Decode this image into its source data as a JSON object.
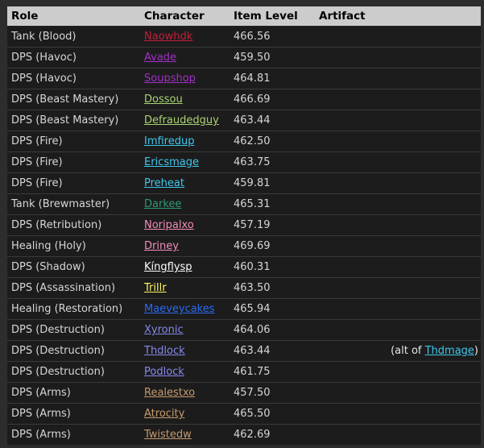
{
  "table": {
    "header": {
      "role": "Role",
      "character": "Character",
      "item_level": "Item Level",
      "artifact": "Artifact"
    },
    "class_colors": {
      "death-knight": "#C41E3A",
      "demon-hunter": "#A330C9",
      "hunter": "#AAD372",
      "mage": "#3FC7EB",
      "monk": "#2E9B77",
      "paladin": "#F48CBA",
      "priest": "#FFFFFF",
      "rogue": "#FFF468",
      "shaman": "#2B6AF0",
      "warlock": "#8788EE",
      "warrior": "#C69B6D"
    },
    "rows": [
      {
        "role": "Tank (Blood)",
        "character": "Naowhdk",
        "class": "death-knight",
        "item_level": "466.56",
        "artifact": null
      },
      {
        "role": "DPS (Havoc)",
        "character": "Avade",
        "class": "demon-hunter",
        "item_level": "459.50",
        "artifact": null
      },
      {
        "role": "DPS (Havoc)",
        "character": "Soupshop",
        "class": "demon-hunter",
        "item_level": "464.81",
        "artifact": null
      },
      {
        "role": "DPS (Beast Mastery)",
        "character": "Dossou",
        "class": "hunter",
        "item_level": "466.69",
        "artifact": null
      },
      {
        "role": "DPS (Beast Mastery)",
        "character": "Defraudedguy",
        "class": "hunter",
        "item_level": "463.44",
        "artifact": null
      },
      {
        "role": "DPS (Fire)",
        "character": "Imfiredup",
        "class": "mage",
        "item_level": "462.50",
        "artifact": null
      },
      {
        "role": "DPS (Fire)",
        "character": "Ericsmage",
        "class": "mage",
        "item_level": "463.75",
        "artifact": null
      },
      {
        "role": "DPS (Fire)",
        "character": "Preheat",
        "class": "mage",
        "item_level": "459.81",
        "artifact": null
      },
      {
        "role": "Tank (Brewmaster)",
        "character": "Darkee",
        "class": "monk",
        "item_level": "465.31",
        "artifact": null
      },
      {
        "role": "DPS (Retribution)",
        "character": "Noripalxo",
        "class": "paladin",
        "item_level": "457.19",
        "artifact": null
      },
      {
        "role": "Healing (Holy)",
        "character": "Driney",
        "class": "paladin",
        "item_level": "469.69",
        "artifact": null
      },
      {
        "role": "DPS (Shadow)",
        "character": "Kíngflysp",
        "class": "priest",
        "item_level": "460.31",
        "artifact": null
      },
      {
        "role": "DPS (Assassination)",
        "character": "Trillr",
        "class": "rogue",
        "item_level": "463.50",
        "artifact": null
      },
      {
        "role": "Healing (Restoration)",
        "character": "Maeveycakes",
        "class": "shaman",
        "item_level": "465.94",
        "artifact": null
      },
      {
        "role": "DPS (Destruction)",
        "character": "Xyronic",
        "class": "warlock",
        "item_level": "464.06",
        "artifact": null
      },
      {
        "role": "DPS (Destruction)",
        "character": "Thdlock",
        "class": "warlock",
        "item_level": "463.44",
        "artifact": {
          "prefix": "(alt of ",
          "link": "Thdmage",
          "link_class": "mage",
          "suffix": ")"
        }
      },
      {
        "role": "DPS (Destruction)",
        "character": "Podlock",
        "class": "warlock",
        "item_level": "461.75",
        "artifact": null
      },
      {
        "role": "DPS (Arms)",
        "character": "Realestxo",
        "class": "warrior",
        "item_level": "457.50",
        "artifact": null
      },
      {
        "role": "DPS (Arms)",
        "character": "Atrocity",
        "class": "warrior",
        "item_level": "465.50",
        "artifact": null
      },
      {
        "role": "DPS (Arms)",
        "character": "Twistedw",
        "class": "warrior",
        "item_level": "462.69",
        "artifact": null
      }
    ]
  }
}
